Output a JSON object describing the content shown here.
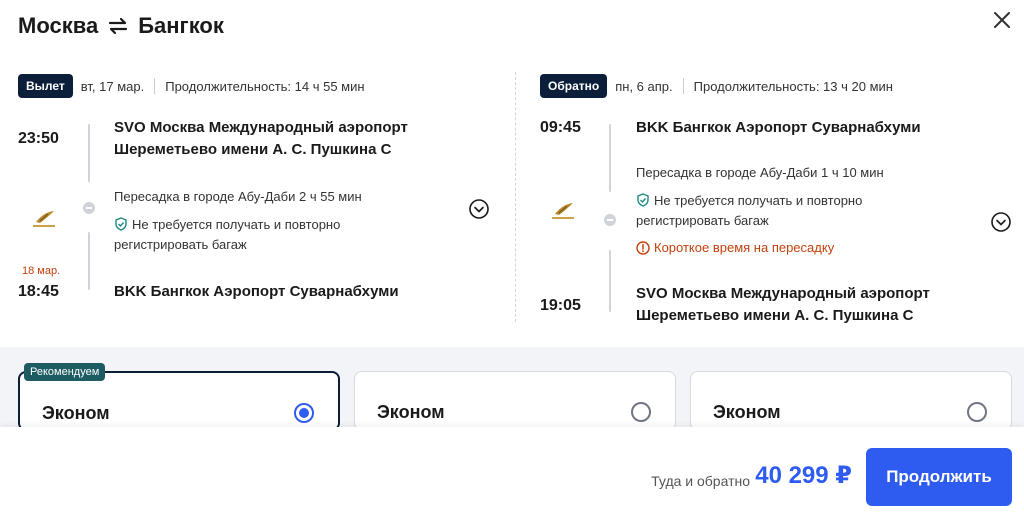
{
  "header": {
    "origin": "Москва",
    "destination": "Бангкок",
    "close_icon": "close-icon",
    "swap_icon": "swap-arrows-icon"
  },
  "outbound": {
    "badge": "Вылет",
    "date": "вт, 17 мар.",
    "duration": "Продолжительность: 14 ч 55 мин",
    "depart_time": "23:50",
    "depart_airport_line1": "SVO Москва Международный аэропорт",
    "depart_airport_line2": "Шереметьево имени А. С. Пушкина C",
    "transfer": "Пересадка в городе Абу-Даби  2 ч 55 мин",
    "baggage_line1": "Не требуется получать и повторно",
    "baggage_line2": "регистрировать багаж",
    "arrive_date": "18 мар.",
    "arrive_time": "18:45",
    "arrive_airport": "BKK Бангкок Аэропорт Суварнабхуми"
  },
  "return": {
    "badge": "Обратно",
    "date": "пн, 6 апр.",
    "duration": "Продолжительность: 13 ч 20 мин",
    "depart_time": "09:45",
    "depart_airport": "BKK Бангкок Аэропорт Суварнабхуми",
    "transfer": "Пересадка в городе Абу-Даби  1 ч 10 мин",
    "baggage_line1": "Не требуется получать и повторно",
    "baggage_line2": "регистрировать багаж",
    "warning": "Короткое время на пересадку",
    "arrive_time": "19:05",
    "arrive_airport_line1": "SVO Москва Международный аэропорт",
    "arrive_airport_line2": "Шереметьево имени А. С. Пушкина C"
  },
  "tariffs": {
    "recommended_label": "Рекомендуем",
    "items": [
      {
        "name": "Эконом",
        "selected": true
      },
      {
        "name": "Эконом",
        "selected": false
      },
      {
        "name": "Эконом",
        "selected": false
      }
    ]
  },
  "footer": {
    "total_label": "Туда и обратно",
    "total_price": "40 299 ₽",
    "continue_label": "Продолжить"
  },
  "colors": {
    "accent": "#2f5cf0",
    "badge_dark": "#0b1f3a",
    "recommend_badge": "#1d5c63",
    "warning": "#c2410c"
  }
}
